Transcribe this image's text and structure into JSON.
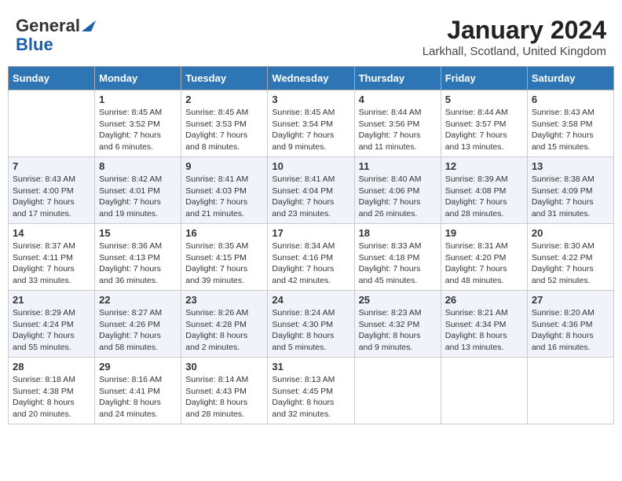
{
  "header": {
    "logo": {
      "general": "General",
      "blue": "Blue"
    },
    "title": "January 2024",
    "subtitle": "Larkhall, Scotland, United Kingdom"
  },
  "calendar": {
    "headers": [
      "Sunday",
      "Monday",
      "Tuesday",
      "Wednesday",
      "Thursday",
      "Friday",
      "Saturday"
    ],
    "weeks": [
      [
        {
          "day": "",
          "info": ""
        },
        {
          "day": "1",
          "info": "Sunrise: 8:45 AM\nSunset: 3:52 PM\nDaylight: 7 hours\nand 6 minutes."
        },
        {
          "day": "2",
          "info": "Sunrise: 8:45 AM\nSunset: 3:53 PM\nDaylight: 7 hours\nand 8 minutes."
        },
        {
          "day": "3",
          "info": "Sunrise: 8:45 AM\nSunset: 3:54 PM\nDaylight: 7 hours\nand 9 minutes."
        },
        {
          "day": "4",
          "info": "Sunrise: 8:44 AM\nSunset: 3:56 PM\nDaylight: 7 hours\nand 11 minutes."
        },
        {
          "day": "5",
          "info": "Sunrise: 8:44 AM\nSunset: 3:57 PM\nDaylight: 7 hours\nand 13 minutes."
        },
        {
          "day": "6",
          "info": "Sunrise: 8:43 AM\nSunset: 3:58 PM\nDaylight: 7 hours\nand 15 minutes."
        }
      ],
      [
        {
          "day": "7",
          "info": "Sunrise: 8:43 AM\nSunset: 4:00 PM\nDaylight: 7 hours\nand 17 minutes."
        },
        {
          "day": "8",
          "info": "Sunrise: 8:42 AM\nSunset: 4:01 PM\nDaylight: 7 hours\nand 19 minutes."
        },
        {
          "day": "9",
          "info": "Sunrise: 8:41 AM\nSunset: 4:03 PM\nDaylight: 7 hours\nand 21 minutes."
        },
        {
          "day": "10",
          "info": "Sunrise: 8:41 AM\nSunset: 4:04 PM\nDaylight: 7 hours\nand 23 minutes."
        },
        {
          "day": "11",
          "info": "Sunrise: 8:40 AM\nSunset: 4:06 PM\nDaylight: 7 hours\nand 26 minutes."
        },
        {
          "day": "12",
          "info": "Sunrise: 8:39 AM\nSunset: 4:08 PM\nDaylight: 7 hours\nand 28 minutes."
        },
        {
          "day": "13",
          "info": "Sunrise: 8:38 AM\nSunset: 4:09 PM\nDaylight: 7 hours\nand 31 minutes."
        }
      ],
      [
        {
          "day": "14",
          "info": "Sunrise: 8:37 AM\nSunset: 4:11 PM\nDaylight: 7 hours\nand 33 minutes."
        },
        {
          "day": "15",
          "info": "Sunrise: 8:36 AM\nSunset: 4:13 PM\nDaylight: 7 hours\nand 36 minutes."
        },
        {
          "day": "16",
          "info": "Sunrise: 8:35 AM\nSunset: 4:15 PM\nDaylight: 7 hours\nand 39 minutes."
        },
        {
          "day": "17",
          "info": "Sunrise: 8:34 AM\nSunset: 4:16 PM\nDaylight: 7 hours\nand 42 minutes."
        },
        {
          "day": "18",
          "info": "Sunrise: 8:33 AM\nSunset: 4:18 PM\nDaylight: 7 hours\nand 45 minutes."
        },
        {
          "day": "19",
          "info": "Sunrise: 8:31 AM\nSunset: 4:20 PM\nDaylight: 7 hours\nand 48 minutes."
        },
        {
          "day": "20",
          "info": "Sunrise: 8:30 AM\nSunset: 4:22 PM\nDaylight: 7 hours\nand 52 minutes."
        }
      ],
      [
        {
          "day": "21",
          "info": "Sunrise: 8:29 AM\nSunset: 4:24 PM\nDaylight: 7 hours\nand 55 minutes."
        },
        {
          "day": "22",
          "info": "Sunrise: 8:27 AM\nSunset: 4:26 PM\nDaylight: 7 hours\nand 58 minutes."
        },
        {
          "day": "23",
          "info": "Sunrise: 8:26 AM\nSunset: 4:28 PM\nDaylight: 8 hours\nand 2 minutes."
        },
        {
          "day": "24",
          "info": "Sunrise: 8:24 AM\nSunset: 4:30 PM\nDaylight: 8 hours\nand 5 minutes."
        },
        {
          "day": "25",
          "info": "Sunrise: 8:23 AM\nSunset: 4:32 PM\nDaylight: 8 hours\nand 9 minutes."
        },
        {
          "day": "26",
          "info": "Sunrise: 8:21 AM\nSunset: 4:34 PM\nDaylight: 8 hours\nand 13 minutes."
        },
        {
          "day": "27",
          "info": "Sunrise: 8:20 AM\nSunset: 4:36 PM\nDaylight: 8 hours\nand 16 minutes."
        }
      ],
      [
        {
          "day": "28",
          "info": "Sunrise: 8:18 AM\nSunset: 4:38 PM\nDaylight: 8 hours\nand 20 minutes."
        },
        {
          "day": "29",
          "info": "Sunrise: 8:16 AM\nSunset: 4:41 PM\nDaylight: 8 hours\nand 24 minutes."
        },
        {
          "day": "30",
          "info": "Sunrise: 8:14 AM\nSunset: 4:43 PM\nDaylight: 8 hours\nand 28 minutes."
        },
        {
          "day": "31",
          "info": "Sunrise: 8:13 AM\nSunset: 4:45 PM\nDaylight: 8 hours\nand 32 minutes."
        },
        {
          "day": "",
          "info": ""
        },
        {
          "day": "",
          "info": ""
        },
        {
          "day": "",
          "info": ""
        }
      ]
    ]
  }
}
